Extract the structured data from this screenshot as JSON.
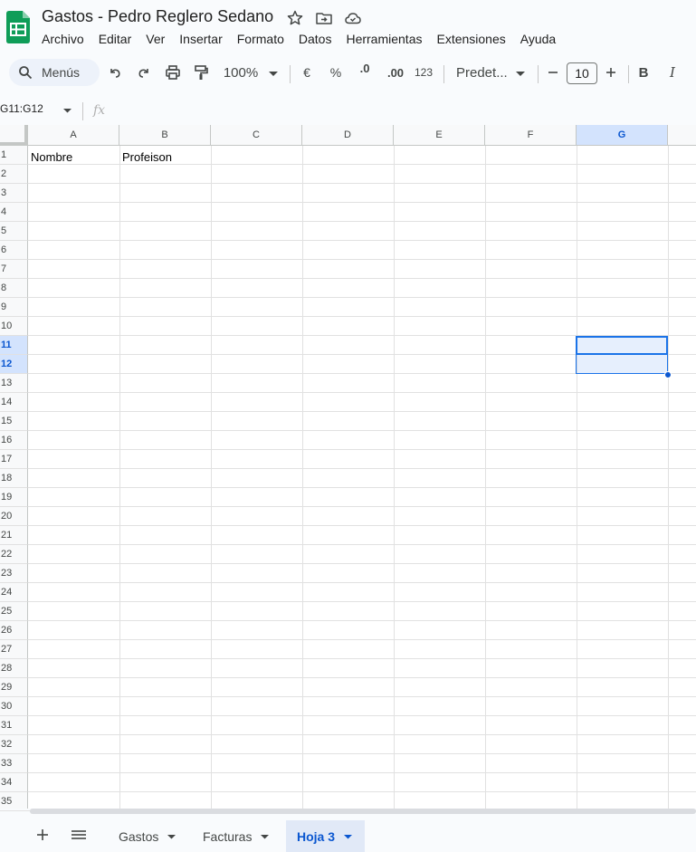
{
  "app": {
    "title": "Gastos - Pedro Reglero Sedano",
    "accent": "#0b57d0",
    "logo_color": "#0f9d58"
  },
  "menu": [
    "Archivo",
    "Editar",
    "Ver",
    "Insertar",
    "Formato",
    "Datos",
    "Herramientas",
    "Extensiones",
    "Ayuda"
  ],
  "toolbar": {
    "search_label": "Menús",
    "zoom": "100%",
    "currency": "€",
    "percent": "%",
    "decrease_decimals": ".0",
    "increase_decimals": ".00",
    "number_format": "123",
    "font": "Predet...",
    "font_size": "10",
    "bold": "B",
    "italic": "I"
  },
  "formula_bar": {
    "name_box": "G11:G12",
    "fx": "fx"
  },
  "grid": {
    "columns": [
      "A",
      "B",
      "C",
      "D",
      "E",
      "F",
      "G"
    ],
    "rows": [
      "1",
      "2",
      "3",
      "4",
      "5",
      "6",
      "7",
      "8",
      "9",
      "10",
      "11",
      "12",
      "13",
      "14",
      "15",
      "16",
      "17",
      "18",
      "19",
      "20",
      "21",
      "22",
      "23",
      "24",
      "25",
      "26",
      "27",
      "28",
      "29",
      "30",
      "31",
      "32",
      "33",
      "34",
      "35"
    ],
    "selected_column": "G",
    "selected_rows": [
      "11",
      "12"
    ],
    "cells": {
      "A1": "Nombre",
      "B1": "Profeison"
    }
  },
  "sheets": {
    "tabs": [
      "Gastos",
      "Facturas",
      "Hoja 3"
    ],
    "active": "Hoja 3"
  }
}
